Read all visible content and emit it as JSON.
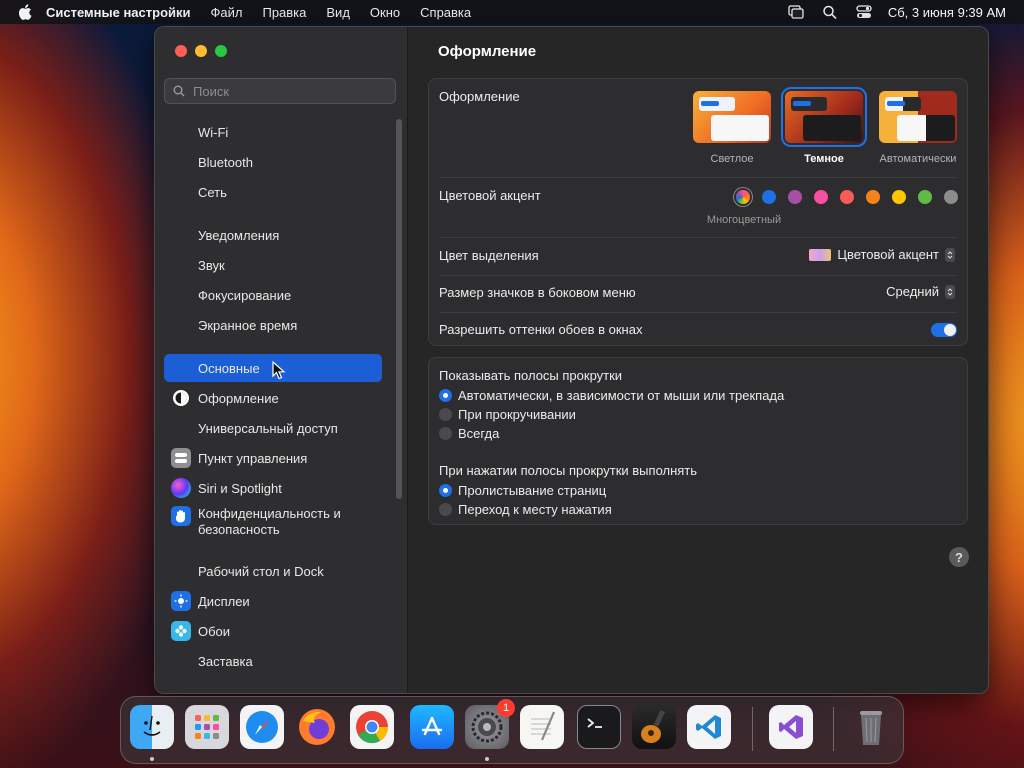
{
  "menubar": {
    "app_name": "Системные настройки",
    "items": [
      "Файл",
      "Правка",
      "Вид",
      "Окно",
      "Справка"
    ],
    "clock": "Сб, 3 июня  9:39 AM"
  },
  "sidebar": {
    "search_placeholder": "Поиск",
    "items": [
      {
        "label": "Wi-Fi",
        "icon": "wifi-icon"
      },
      {
        "label": "Bluetooth",
        "icon": "bluetooth-icon"
      },
      {
        "label": "Сеть",
        "icon": "network-icon"
      },
      {
        "label": "Уведомления",
        "icon": "notifications-icon"
      },
      {
        "label": "Звук",
        "icon": "sound-icon"
      },
      {
        "label": "Фокусирование",
        "icon": "focus-icon"
      },
      {
        "label": "Экранное время",
        "icon": "screen-time-icon"
      },
      {
        "label": "Основные",
        "icon": "general-icon",
        "selected": true
      },
      {
        "label": "Оформление",
        "icon": "appearance-icon"
      },
      {
        "label": "Универсальный доступ",
        "icon": "accessibility-icon"
      },
      {
        "label": "Пункт управления",
        "icon": "control-center-icon"
      },
      {
        "label": "Siri и Spotlight",
        "icon": "siri-icon"
      },
      {
        "label": "Конфиденциальность и",
        "label2": "безопасность",
        "icon": "privacy-hand-icon"
      },
      {
        "label": "Рабочий стол и Dock",
        "icon": "desktop-dock-icon"
      },
      {
        "label": "Дисплеи",
        "icon": "displays-icon"
      },
      {
        "label": "Обои",
        "icon": "wallpaper-icon"
      },
      {
        "label": "Заставка",
        "icon": "screensaver-icon"
      }
    ]
  },
  "main": {
    "title": "Оформление",
    "appearance": {
      "label": "Оформление",
      "options": [
        "Светлое",
        "Темное",
        "Автоматически"
      ],
      "selected": "Темное"
    },
    "accent": {
      "label": "Цветовой акцент",
      "caption": "Многоцветный",
      "colors": [
        "#1f6fe5",
        "#a550a7",
        "#f74f9e",
        "#fc5a55",
        "#f7821b",
        "#ffc600",
        "#62ba46",
        "#8c8c8c"
      ]
    },
    "highlight": {
      "label": "Цвет выделения",
      "value": "Цветовой акцент"
    },
    "sidebar_icon_size": {
      "label": "Размер значков в боковом меню",
      "value": "Средний"
    },
    "wallpaper_tinting": {
      "label": "Разрешить оттенки обоев в окнах",
      "on": true
    },
    "scrollbars": {
      "label": "Показывать полосы прокрутки",
      "options": [
        "Автоматически, в зависимости от мыши или трекпада",
        "При прокручивании",
        "Всегда"
      ],
      "selected": 0
    },
    "click_scroll": {
      "label": "При нажатии полосы прокрутки выполнять",
      "options": [
        "Пролистывание страниц",
        "Переход к месту нажатия"
      ],
      "selected": 0
    },
    "help": "?"
  },
  "dock": {
    "apps": [
      "Finder",
      "Launchpad",
      "Safari",
      "Firefox",
      "Chrome",
      "App Store",
      "System Settings",
      "TextEdit",
      "Terminal",
      "GarageBand",
      "VS Code",
      "Visual Studio",
      "Trash"
    ],
    "settings_badge": "1"
  }
}
